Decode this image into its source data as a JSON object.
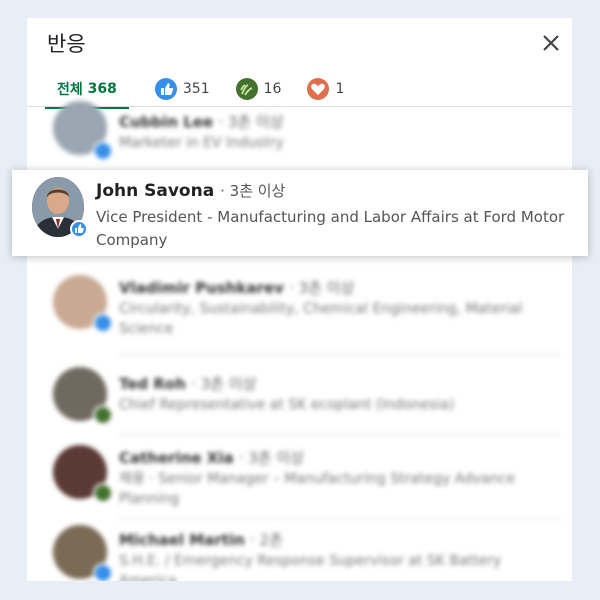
{
  "header": {
    "title": "반응"
  },
  "tabs": [
    {
      "label": "전체",
      "count": "368"
    },
    {
      "icon": "like-icon",
      "count": "351"
    },
    {
      "icon": "celebrate-icon",
      "count": "16"
    },
    {
      "icon": "love-icon",
      "count": "1"
    }
  ],
  "colors": {
    "accent": "#057642",
    "like": "#378fe9",
    "celebrate": "#44712e",
    "love": "#df704d"
  },
  "people": [
    {
      "name": "Cubbin Lee",
      "degree": "· 3촌 이상",
      "role": "Marketer in EV Industry"
    },
    {
      "name": "John Savona",
      "degree": "· 3촌 이상",
      "role": "Vice President - Manufacturing and Labor Affairs at Ford Motor Company"
    },
    {
      "name": "Vladimir Pushkarev",
      "degree": "· 3촌 이상",
      "role": "Circularity, Sustainability, Chemical Engineering, Material Science"
    },
    {
      "name": "Ted Roh",
      "degree": "· 3촌 이상",
      "role": "Chief Representative at SK ecoplant (Indonesia)"
    },
    {
      "name": "Catherine Xia",
      "degree": "· 3촌 이상",
      "role": "채용 · Senior Manager – Manufacturing Strategy Advance Planning"
    },
    {
      "name": "Michael Martin",
      "degree": "· 2촌",
      "role": "S.H.E. / Emergency Response Supervisor at SK Battery America"
    }
  ]
}
